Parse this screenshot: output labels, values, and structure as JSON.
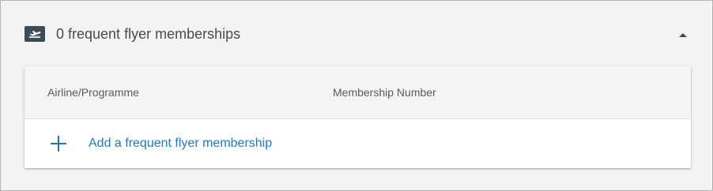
{
  "section": {
    "title": "0 frequent flyer memberships",
    "icon": "airplane-departure-icon",
    "toggle_icon": "caret-up-icon"
  },
  "table": {
    "columns": [
      "Airline/Programme",
      "Membership Number"
    ],
    "rows": []
  },
  "add_action": {
    "label": "Add a frequent flyer membership",
    "icon": "plus-icon"
  },
  "colors": {
    "accent": "#1a7ac8",
    "icon_bg": "#3f4a57"
  }
}
